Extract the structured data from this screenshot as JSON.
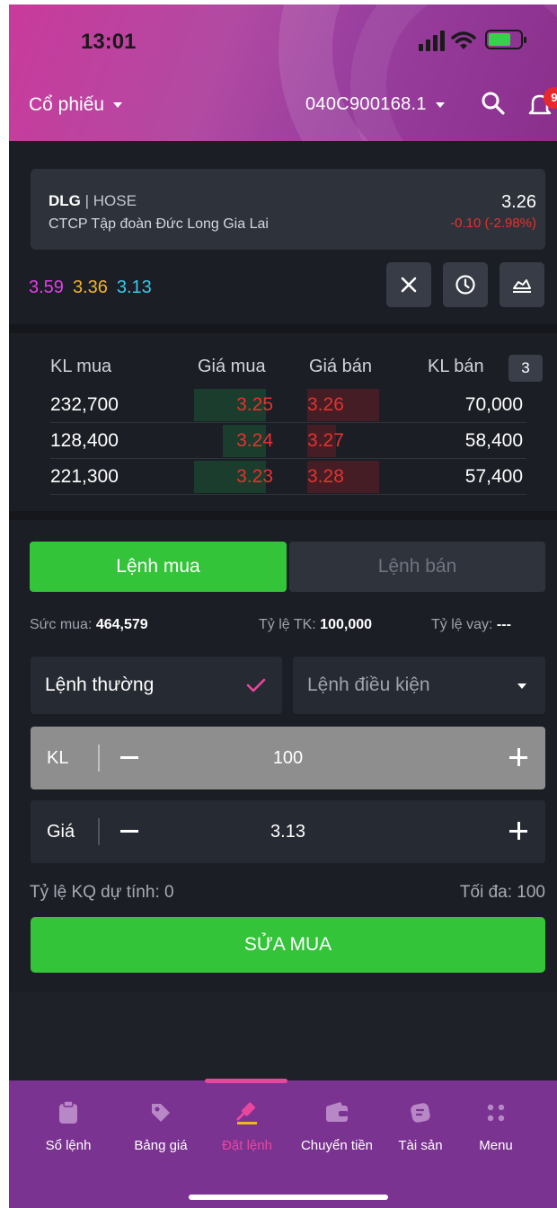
{
  "status_bar": {
    "time": "13:01"
  },
  "header": {
    "category": "Cổ phiếu",
    "account": "040C900168.1",
    "notification_count": "9"
  },
  "stock": {
    "symbol": "DLG",
    "exchange": "| HOSE",
    "company": "CTCP Tập đoàn Đức Long Gia Lai",
    "price": "3.26",
    "change": "-0.10 (-2.98%)"
  },
  "ref_prices": {
    "ceiling": "3.59",
    "reference": "3.36",
    "floor": "3.13"
  },
  "order_book": {
    "headers": {
      "buy_vol": "KL mua",
      "bid": "Giá mua",
      "ask": "Giá bán",
      "sell_vol": "KL bán"
    },
    "depth": "3",
    "rows": [
      {
        "buy_vol": "232,700",
        "bid": "3.25",
        "ask": "3.26",
        "sell_vol": "70,000"
      },
      {
        "buy_vol": "128,400",
        "bid": "3.24",
        "ask": "3.27",
        "sell_vol": "58,400"
      },
      {
        "buy_vol": "221,300",
        "bid": "3.23",
        "ask": "3.28",
        "sell_vol": "57,400"
      }
    ]
  },
  "tabs": {
    "buy": "Lệnh mua",
    "sell": "Lệnh bán"
  },
  "stats": {
    "purchasing_label": "Sức mua:",
    "purchasing_value": "464,579",
    "ratio_label": "Tỷ lệ TK:",
    "ratio_value": "100,000",
    "loan_label": "Tỷ lệ vay:",
    "loan_value": "---"
  },
  "order_type": {
    "normal": "Lệnh thường",
    "conditional": "Lệnh điều kiện"
  },
  "quantity": {
    "label": "KL",
    "value": "100"
  },
  "price_field": {
    "label": "Giá",
    "value": "3.13"
  },
  "estimate": {
    "ratio": "Tỷ lệ KQ dự tính: 0",
    "max": "Tối đa: 100"
  },
  "submit_label": "SỬA MUA",
  "nav": [
    {
      "label": "Sổ lệnh",
      "icon": "clipboard-icon"
    },
    {
      "label": "Bảng giá",
      "icon": "tag-icon"
    },
    {
      "label": "Đặt lệnh",
      "icon": "gavel-icon",
      "active": true
    },
    {
      "label": "Chuyển tiền",
      "icon": "wallet-icon"
    },
    {
      "label": "Tài sản",
      "icon": "asset-icon"
    },
    {
      "label": "Menu",
      "icon": "menu-dots-icon"
    }
  ],
  "colors": {
    "accent": "#34c43a",
    "down": "#e5322e",
    "ceiling": "#e43ee8",
    "reference": "#f0b429",
    "floor": "#36c9ea",
    "nav_active": "#e8479e"
  }
}
